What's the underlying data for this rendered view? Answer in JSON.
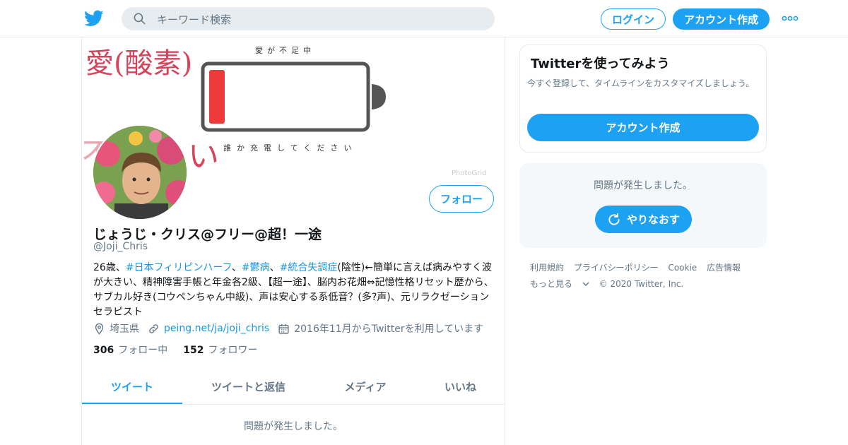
{
  "header": {
    "search_placeholder": "キーワード検索",
    "login_label": "ログイン",
    "signup_label": "アカウント作成"
  },
  "banner": {
    "headline": "愛(酸素)",
    "top_text": "愛が不足中",
    "bottom_text": "誰か充電してください",
    "right_char": "い",
    "left_char": "不",
    "watermark": "PhotoGrid"
  },
  "profile": {
    "name": "じょうじ・クリス@フリー@超！一途",
    "handle": "@Joji_Chris",
    "follow_label": "フォロー",
    "bio": {
      "p1": "26歳、",
      "tag1": "#日本フィリピンハーフ",
      "p2": "、",
      "tag2": "#鬱病",
      "p3": "、",
      "tag3": "#統合失調症",
      "p4": "(陰性)←簡単に言えば病みやすく波が大きい、精神障害手帳と年金各2級、【超一途】、脳内お花畑⇔記憶性格リセット歴から、サブカル好き(コウペンちゃん中級)、声は安心する系低音？(多?声)、元リラクゼーションセラピスト"
    },
    "location": "埼玉県",
    "link": "peing.net/ja/joji_chris",
    "joined": "2016年11月からTwitterを利用しています",
    "following_count": "306",
    "following_label": "フォロー中",
    "followers_count": "152",
    "followers_label": "フォロワー"
  },
  "tabs": [
    "ツイート",
    "ツイートと返信",
    "メディア",
    "いいね"
  ],
  "main_error": "問題が発生しました。",
  "sidebar": {
    "signup_card": {
      "title": "Twitterを使ってみよう",
      "subtitle": "今すぐ登録して、タイムラインをカスタマイズしましょう。",
      "button": "アカウント作成"
    },
    "error_card": {
      "message": "問題が発生しました。",
      "retry": "やりなおす"
    },
    "footer": {
      "links": [
        "利用規約",
        "プライバシーポリシー",
        "Cookie",
        "広告情報"
      ],
      "more": "もっと見る",
      "copyright": "© 2020 Twitter, Inc."
    }
  },
  "colors": {
    "brand": "#1da1f2",
    "link": "#1b95e0",
    "muted": "#657786",
    "battery_red": "#ee3a3a"
  },
  "icons": [
    "twitter-logo-icon",
    "search-icon",
    "more-dots-icon",
    "location-icon",
    "link-icon",
    "calendar-icon",
    "refresh-icon",
    "chevron-down-icon"
  ]
}
